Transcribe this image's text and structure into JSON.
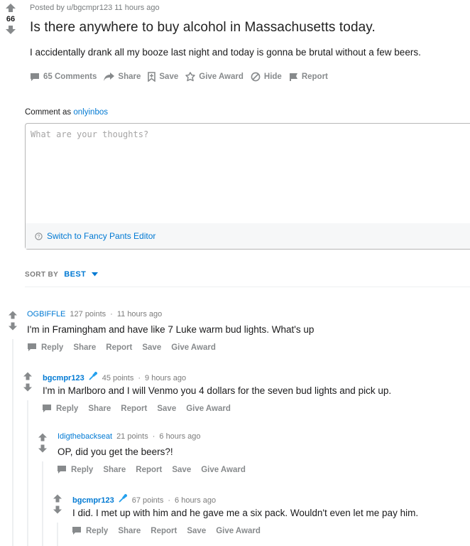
{
  "post": {
    "score": "66",
    "meta": "Posted by u/bgcmpr123 11 hours ago",
    "title": "Is there anywhere to buy alcohol in Massachusetts today.",
    "body": "I accidentally drank all my booze last night and today is gonna be brutal without a few beers.",
    "actions": {
      "comments": "65 Comments",
      "share": "Share",
      "save": "Save",
      "award": "Give Award",
      "hide": "Hide",
      "report": "Report"
    }
  },
  "composer": {
    "comment_as_prefix": "Comment as",
    "username": "onlyinbos",
    "placeholder": "What are your thoughts?",
    "switch_editor": "Switch to Fancy Pants Editor"
  },
  "sort": {
    "label": "SORT BY",
    "value": "BEST"
  },
  "comments": [
    {
      "author": "OGBIFFLE",
      "points": "127 points",
      "time": "11 hours ago",
      "body": "I'm in Framingham and have like 7 Luke warm bud lights. What's up",
      "actions": {
        "reply": "Reply",
        "share": "Share",
        "report": "Report",
        "save": "Save",
        "award": "Give Award"
      }
    },
    {
      "author": "bgcmpr123",
      "points": "45 points",
      "time": "9 hours ago",
      "body": "I'm in Marlboro and I will Venmo you 4 dollars for the seven bud lights and pick up.",
      "actions": {
        "reply": "Reply",
        "share": "Share",
        "report": "Report",
        "save": "Save",
        "award": "Give Award"
      }
    },
    {
      "author": "Idigthebackseat",
      "points": "21 points",
      "time": "6 hours ago",
      "body": "OP, did you get the beers?!",
      "actions": {
        "reply": "Reply",
        "share": "Share",
        "report": "Report",
        "save": "Save",
        "award": "Give Award"
      }
    },
    {
      "author": "bgcmpr123",
      "points": "67 points",
      "time": "6 hours ago",
      "body": "I did. I met up with him and he gave me a six pack. Wouldn't even let me pay him.",
      "actions": {
        "reply": "Reply",
        "share": "Share",
        "report": "Report",
        "save": "Save",
        "award": "Give Award"
      }
    }
  ],
  "colors": {
    "link": "#0079d3",
    "muted": "#878a8c",
    "text": "#1a1a1b"
  }
}
